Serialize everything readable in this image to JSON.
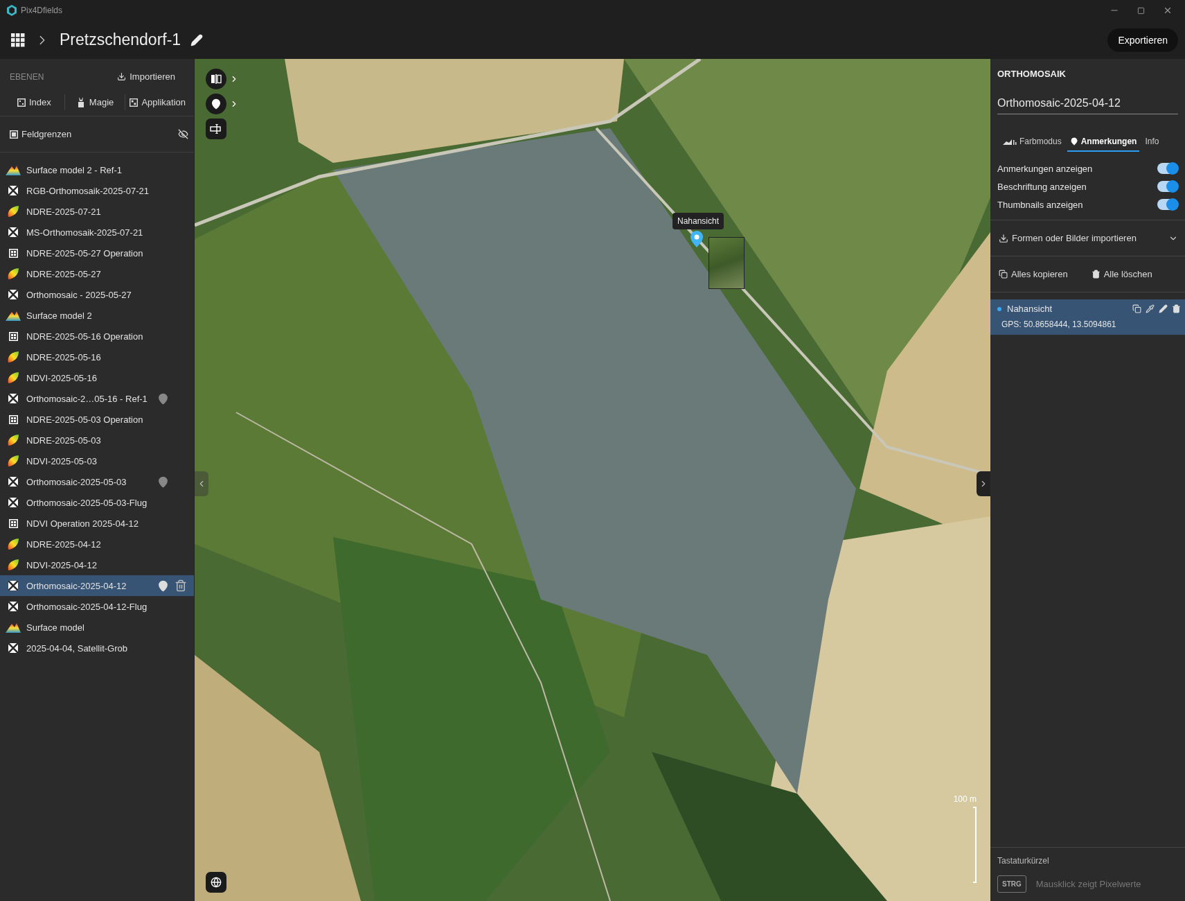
{
  "window": {
    "title": "Pix4Dfields"
  },
  "header": {
    "project": "Pretzschendorf-1",
    "export_button": "Exportieren"
  },
  "layers_panel": {
    "heading": "EBENEN",
    "import_button": "Importieren",
    "actions": [
      {
        "kind": "index",
        "label": "Index"
      },
      {
        "kind": "magic",
        "label": "Magie"
      },
      {
        "kind": "application",
        "label": "Applikation"
      }
    ],
    "boundaries": {
      "label": "Feldgrenzen",
      "visible": false
    },
    "layers": [
      {
        "kind": "surface",
        "name": "Surface model 2 - Ref-1",
        "pinned": false,
        "selected": false
      },
      {
        "kind": "ortho",
        "name": "RGB-Orthomosaik-2025-07-21",
        "pinned": false,
        "selected": false
      },
      {
        "kind": "index",
        "name": "NDRE-2025-07-21",
        "pinned": false,
        "selected": false
      },
      {
        "kind": "ortho",
        "name": "MS-Orthomosaik-2025-07-21",
        "pinned": false,
        "selected": false
      },
      {
        "kind": "operation",
        "name": "NDRE-2025-05-27 Operation",
        "pinned": false,
        "selected": false
      },
      {
        "kind": "index",
        "name": "NDRE-2025-05-27",
        "pinned": false,
        "selected": false
      },
      {
        "kind": "ortho",
        "name": "Orthomosaic - 2025-05-27",
        "pinned": false,
        "selected": false
      },
      {
        "kind": "surface",
        "name": "Surface model 2",
        "pinned": false,
        "selected": false
      },
      {
        "kind": "operation",
        "name": "NDRE-2025-05-16 Operation",
        "pinned": false,
        "selected": false
      },
      {
        "kind": "index",
        "name": "NDRE-2025-05-16",
        "pinned": false,
        "selected": false
      },
      {
        "kind": "index",
        "name": "NDVI-2025-05-16",
        "pinned": false,
        "selected": false
      },
      {
        "kind": "ortho",
        "name": "Orthomosaic-2…05-16 - Ref-1",
        "pinned": true,
        "selected": false
      },
      {
        "kind": "operation",
        "name": "NDRE-2025-05-03 Operation",
        "pinned": false,
        "selected": false
      },
      {
        "kind": "index",
        "name": "NDRE-2025-05-03",
        "pinned": false,
        "selected": false
      },
      {
        "kind": "index",
        "name": "NDVI-2025-05-03",
        "pinned": false,
        "selected": false
      },
      {
        "kind": "ortho",
        "name": "Orthomosaic-2025-05-03",
        "pinned": true,
        "selected": false
      },
      {
        "kind": "ortho",
        "name": "Orthomosaic-2025-05-03-Flug",
        "pinned": false,
        "selected": false
      },
      {
        "kind": "operation",
        "name": "NDVI Operation 2025-04-12",
        "pinned": false,
        "selected": false
      },
      {
        "kind": "index",
        "name": "NDRE-2025-04-12",
        "pinned": false,
        "selected": false
      },
      {
        "kind": "index",
        "name": "NDVI-2025-04-12",
        "pinned": false,
        "selected": false
      },
      {
        "kind": "ortho",
        "name": "Orthomosaic-2025-04-12",
        "pinned": true,
        "selected": true
      },
      {
        "kind": "ortho",
        "name": "Orthomosaic-2025-04-12-Flug",
        "pinned": false,
        "selected": false
      },
      {
        "kind": "surface",
        "name": "Surface model",
        "pinned": false,
        "selected": false
      },
      {
        "kind": "ortho",
        "name": "2025-04-04, Satellit-Grob",
        "pinned": false,
        "selected": false
      }
    ]
  },
  "map": {
    "annotation_tooltip": "Nahansicht",
    "scale": "100 m"
  },
  "details_panel": {
    "heading": "ORTHOMOSAIK",
    "layer_name": "Orthomosaic-2025-04-12",
    "tabs": [
      {
        "kind": "color",
        "label": "Farbmodus",
        "selected": false
      },
      {
        "kind": "annotations",
        "label": "Anmerkungen",
        "selected": true
      },
      {
        "kind": "info",
        "label": "Info",
        "selected": false
      }
    ],
    "toggles": [
      {
        "label": "Anmerkungen anzeigen",
        "on": true
      },
      {
        "label": "Beschriftung anzeigen",
        "on": true
      },
      {
        "label": "Thumbnails anzeigen",
        "on": true
      }
    ],
    "import_section": "Formen oder Bilder importieren",
    "copy_all": "Alles kopieren",
    "delete_all": "Alle löschen",
    "annotations": [
      {
        "name": "Nahansicht",
        "gps": "GPS: 50.8658444, 13.5094861",
        "selected": true
      }
    ],
    "shortcuts": {
      "heading": "Tastaturkürzel",
      "key": "STRG",
      "description": "Mausklick zeigt Pixelwerte"
    }
  }
}
